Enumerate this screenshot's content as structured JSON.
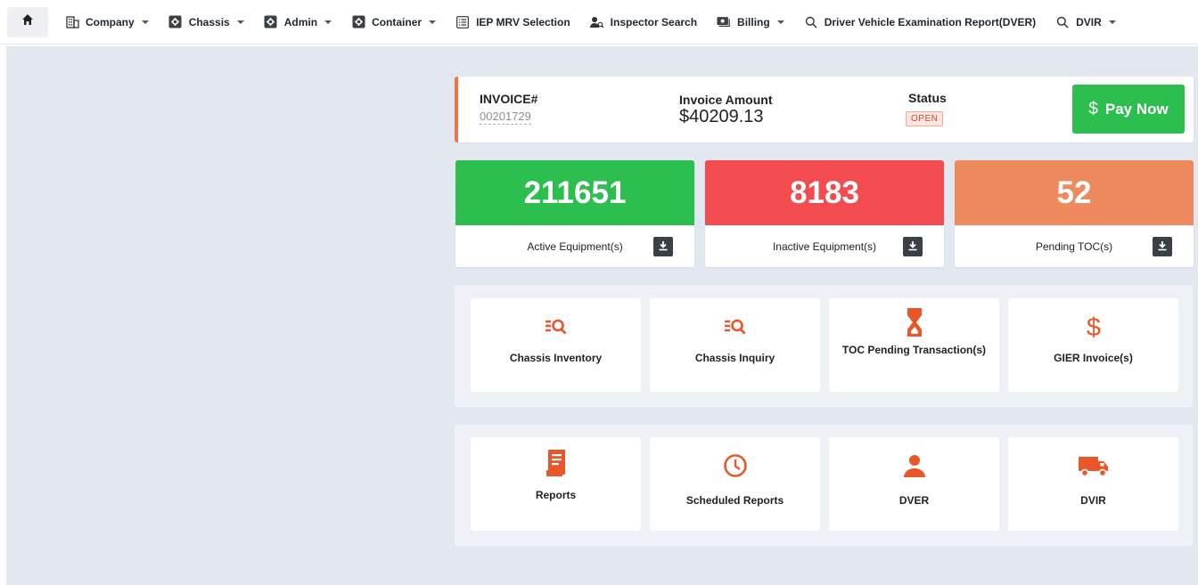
{
  "nav": {
    "items": [
      {
        "label": "Company",
        "icon": "building-icon",
        "dropdown": true
      },
      {
        "label": "Chassis",
        "icon": "gear-box-icon",
        "dropdown": true
      },
      {
        "label": "Admin",
        "icon": "gear-box-icon",
        "dropdown": true
      },
      {
        "label": "Container",
        "icon": "gear-box-icon",
        "dropdown": true
      },
      {
        "label": "IEP MRV Selection",
        "icon": "list-box-icon",
        "dropdown": false
      },
      {
        "label": "Inspector Search",
        "icon": "person-search-icon",
        "dropdown": false
      },
      {
        "label": "Billing",
        "icon": "cash-icon",
        "dropdown": true
      },
      {
        "label": "Driver Vehicle Examination Report(DVER)",
        "icon": "search-icon",
        "dropdown": false
      },
      {
        "label": "DVIR",
        "icon": "search-icon",
        "dropdown": true
      }
    ]
  },
  "invoice": {
    "number_label": "INVOICE#",
    "number": "00201729",
    "amount_label": "Invoice Amount",
    "amount": "$40209.13",
    "status_label": "Status",
    "status": "OPEN",
    "pay_label": "Pay Now",
    "pay_symbol": "$"
  },
  "stats": [
    {
      "value": "211651",
      "label": "Active Equipment(s)",
      "color": "#2dbe50"
    },
    {
      "value": "8183",
      "label": "Inactive Equipment(s)",
      "color": "#f24b50"
    },
    {
      "value": "52",
      "label": "Pending TOC(s)",
      "color": "#ef8a5e"
    }
  ],
  "panel1": [
    {
      "label": "Chassis Inventory",
      "icon": "list-search-icon"
    },
    {
      "label": "Chassis Inquiry",
      "icon": "list-search-icon"
    },
    {
      "label": "TOC Pending Transaction(s)",
      "icon": "hourglass-icon"
    },
    {
      "label": "GIER Invoice(s)",
      "icon": "dollar-icon"
    }
  ],
  "panel2": [
    {
      "label": "Reports",
      "icon": "report-icon"
    },
    {
      "label": "Scheduled Reports",
      "icon": "clock-icon"
    },
    {
      "label": "DVER",
      "icon": "person-icon"
    },
    {
      "label": "DVIR",
      "icon": "truck-icon"
    }
  ],
  "colors": {
    "accent": "#e8572a",
    "green": "#2dbe50",
    "red": "#f24b50",
    "orange": "#ef8a5e"
  }
}
